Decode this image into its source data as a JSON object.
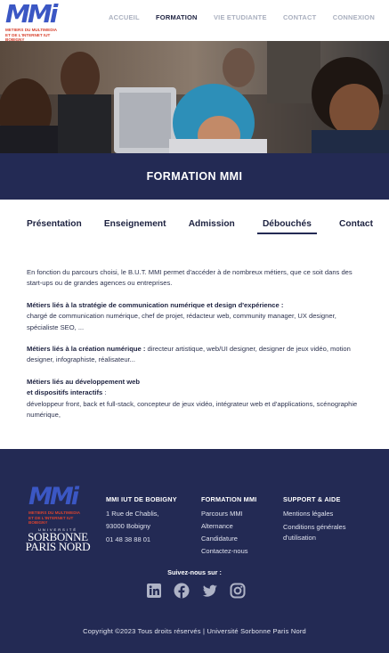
{
  "header": {
    "logo_text": "MMi",
    "logo_subtitle_line1": "METIERS DU MULTIMEDIA",
    "logo_subtitle_line2": "ET DE L'INTERNET IUT BOBIGNY",
    "nav": [
      {
        "label": "ACCUEIL",
        "active": false
      },
      {
        "label": "FORMATION",
        "active": true
      },
      {
        "label": "VIE ETUDIANTE",
        "active": false
      },
      {
        "label": "CONTACT",
        "active": false
      },
      {
        "label": "CONNEXION",
        "active": false
      }
    ]
  },
  "title": "FORMATION MMI",
  "tabs": [
    {
      "label": "Présentation",
      "active": false
    },
    {
      "label": "Enseignement",
      "active": false
    },
    {
      "label": "Admission",
      "active": false
    },
    {
      "label": "Débouchés",
      "active": true
    },
    {
      "label": "Contact",
      "active": false
    }
  ],
  "content": {
    "intro": "En fonction du parcours choisi, le B.U.T. MMI permet d'accéder à de nombreux métiers, que ce soit dans des start-ups ou de grandes agences ou entreprises.",
    "sections": [
      {
        "heading": "Métiers liés à la stratégie de communication numérique et design d'expérience :",
        "heading2": "",
        "text": "chargé de communication numérique, chef de projet, rédacteur web, community manager, UX designer, spécialiste SEO, ..."
      },
      {
        "heading": "Métiers liés à la création numérique :",
        "heading2": "",
        "text": "directeur artistique, web/UI designer, designer de jeux vidéo, motion designer, infographiste, réalisateur..."
      },
      {
        "heading": "Métiers liés au développement web",
        "heading2": "et dispositifs interactifs",
        "text": "développeur front, back et full-stack, concepteur de jeux vidéo, intégrateur web et d'applications, scénographie numérique,"
      }
    ]
  },
  "footer": {
    "university_line1": "UNIVERSITÉ",
    "university_line2": "SORBONNE",
    "university_line3": "PARIS NORD",
    "col1": {
      "title": "MMI IUT DE BOBIGNY",
      "lines": [
        "1 Rue de Chablis,",
        "93000 Bobigny",
        "01 48 38 88 01"
      ]
    },
    "col2": {
      "title": "FORMATION MMI",
      "links": [
        "Parcours MMI",
        "Alternance",
        "Candidature",
        "Contactez-nous"
      ]
    },
    "col3": {
      "title": "SUPPORT & AIDE",
      "links": [
        "Mentions légales",
        "Conditions générales d'utilisation"
      ]
    },
    "follow_label": "Suivez-nous sur :",
    "socials": [
      "linkedin-icon",
      "facebook-icon",
      "twitter-icon",
      "instagram-icon"
    ],
    "copyright": "Copyright ©2023 Tous droits réservés | Université Sorbonne Paris Nord"
  },
  "colors": {
    "navy": "#232a54",
    "logo_blue": "#3b57c4",
    "logo_red": "#e05a3a",
    "nav_inactive": "#aab0bf"
  }
}
